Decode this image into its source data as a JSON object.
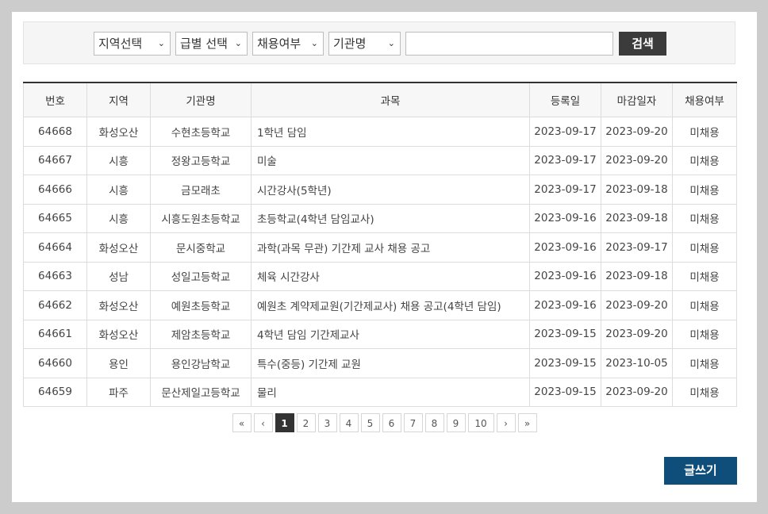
{
  "search": {
    "region_select": "지역선택",
    "grade_select": "급별 선택",
    "hire_select": "채용여부",
    "org_select": "기관명",
    "keyword_value": "",
    "search_label": "검색",
    "chevron": "⌄"
  },
  "table": {
    "headers": {
      "no": "번호",
      "region": "지역",
      "org": "기관명",
      "subject": "과목",
      "reg_date": "등록일",
      "deadline": "마감일자",
      "status": "채용여부"
    },
    "rows": [
      {
        "no": "64668",
        "region": "화성오산",
        "org": "수현초등학교",
        "subject": "1학년 담임",
        "reg": "2023-09-17",
        "deadline": "2023-09-20",
        "status": "미채용"
      },
      {
        "no": "64667",
        "region": "시흥",
        "org": "정왕고등학교",
        "subject": "미술",
        "reg": "2023-09-17",
        "deadline": "2023-09-20",
        "status": "미채용"
      },
      {
        "no": "64666",
        "region": "시흥",
        "org": "금모래초",
        "subject": "시간강사(5학년)",
        "reg": "2023-09-17",
        "deadline": "2023-09-18",
        "status": "미채용"
      },
      {
        "no": "64665",
        "region": "시흥",
        "org": "시흥도원초등학교",
        "subject": "초등학교(4학년 담임교사)",
        "reg": "2023-09-16",
        "deadline": "2023-09-18",
        "status": "미채용"
      },
      {
        "no": "64664",
        "region": "화성오산",
        "org": "문시중학교",
        "subject": "과학(과목 무관) 기간제 교사 채용 공고",
        "reg": "2023-09-16",
        "deadline": "2023-09-17",
        "status": "미채용"
      },
      {
        "no": "64663",
        "region": "성남",
        "org": "성일고등학교",
        "subject": "체육 시간강사",
        "reg": "2023-09-16",
        "deadline": "2023-09-18",
        "status": "미채용"
      },
      {
        "no": "64662",
        "region": "화성오산",
        "org": "예원초등학교",
        "subject": "예원초 계약제교원(기간제교사) 채용 공고(4학년 담임)",
        "reg": "2023-09-16",
        "deadline": "2023-09-20",
        "status": "미채용"
      },
      {
        "no": "64661",
        "region": "화성오산",
        "org": "제암초등학교",
        "subject": "4학년 담임 기간제교사",
        "reg": "2023-09-15",
        "deadline": "2023-09-20",
        "status": "미채용"
      },
      {
        "no": "64660",
        "region": "용인",
        "org": "용인강남학교",
        "subject": "특수(중등) 기간제 교원",
        "reg": "2023-09-15",
        "deadline": "2023-10-05",
        "status": "미채용"
      },
      {
        "no": "64659",
        "region": "파주",
        "org": "문산제일고등학교",
        "subject": "물리",
        "reg": "2023-09-15",
        "deadline": "2023-09-20",
        "status": "미채용"
      }
    ]
  },
  "pagination": {
    "first": "«",
    "prev": "‹",
    "pages": [
      "1",
      "2",
      "3",
      "4",
      "5",
      "6",
      "7",
      "8",
      "9",
      "10"
    ],
    "current": "1",
    "next": "›",
    "last": "»"
  },
  "write_label": "글쓰기"
}
